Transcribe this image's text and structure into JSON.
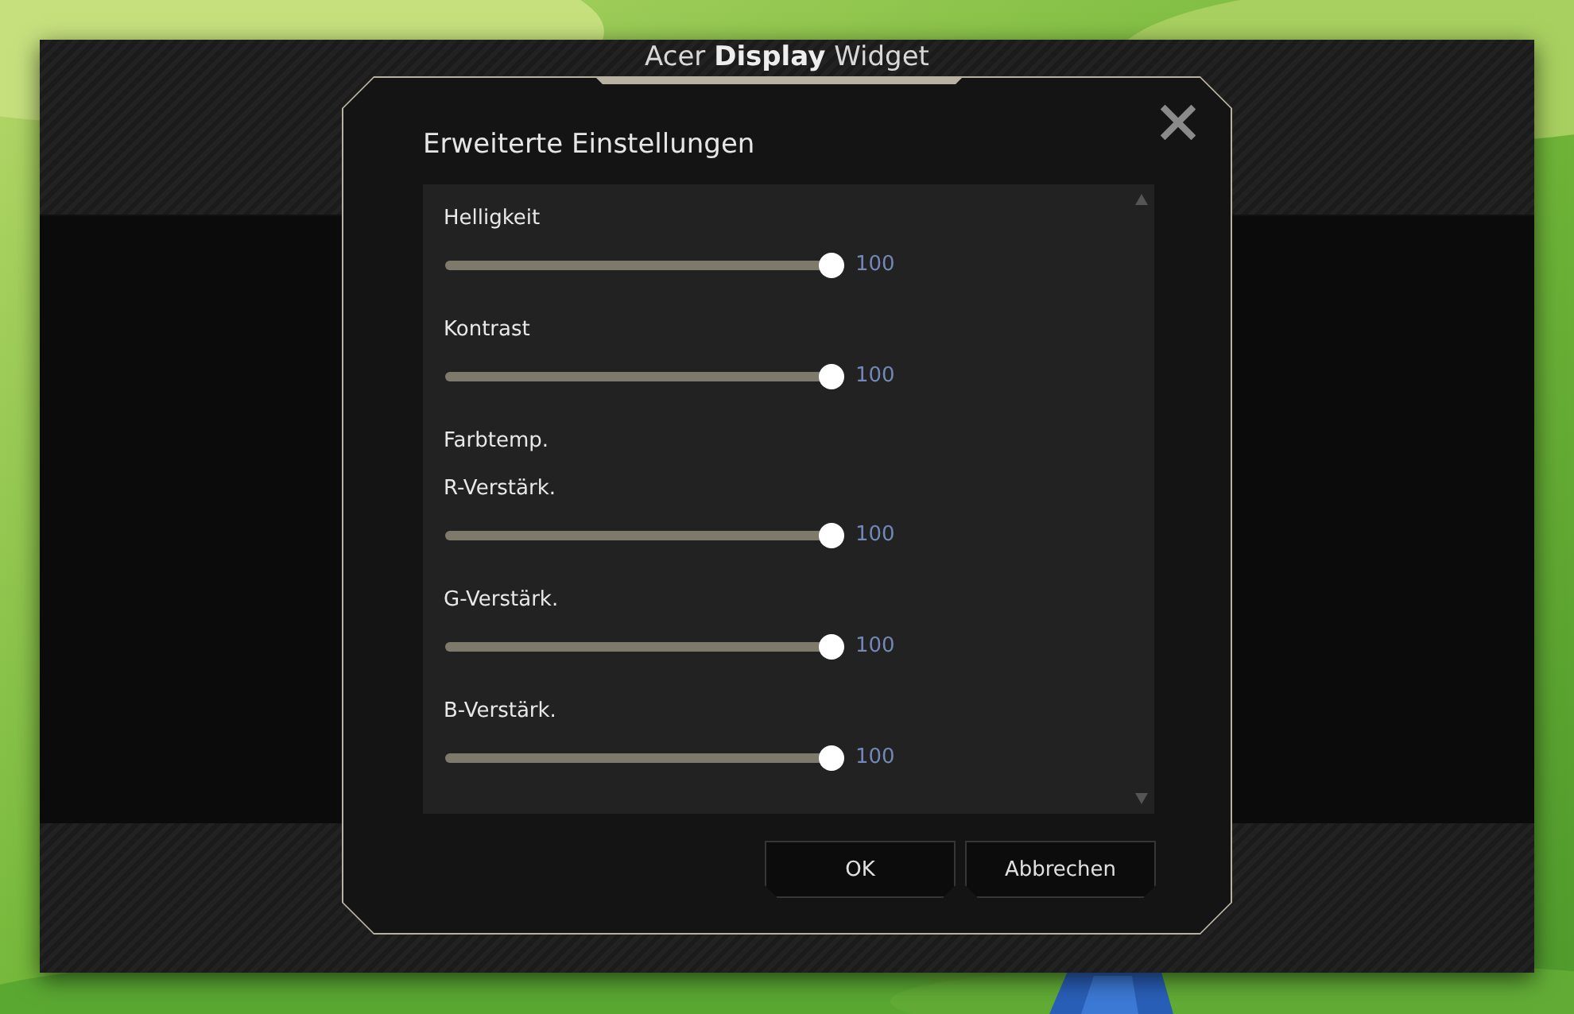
{
  "window": {
    "title": "Acer **Display** Widget"
  },
  "dialog": {
    "title": "Erweiterte Einstellungen",
    "items": [
      {
        "kind": "slider",
        "label": "Helligkeit",
        "level": 1,
        "reading": "100"
      },
      {
        "kind": "slider",
        "label": "Kontrast",
        "level": 1,
        "reading": "100"
      },
      {
        "kind": "heading",
        "label": "Farbtemp."
      },
      {
        "kind": "slider",
        "label": "R-Verstärk.",
        "level": 1,
        "reading": "100"
      },
      {
        "kind": "slider",
        "label": "G-Verstärk.",
        "level": 1,
        "reading": "100"
      },
      {
        "kind": "slider",
        "label": "B-Verstärk.",
        "level": 1,
        "reading": "100"
      }
    ],
    "buttons": [
      {
        "label": "OK"
      },
      {
        "label": "Abbrechen"
      }
    ]
  }
}
